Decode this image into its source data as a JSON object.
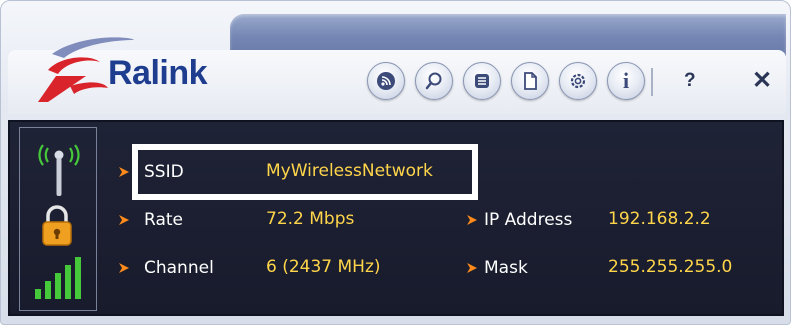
{
  "app": {
    "logo_text": "Ralink"
  },
  "toolbar": {
    "buttons": [
      {
        "icon": "rss-icon"
      },
      {
        "icon": "search-icon"
      },
      {
        "icon": "list-icon"
      },
      {
        "icon": "document-icon"
      },
      {
        "icon": "gear-icon"
      },
      {
        "icon": "info-icon",
        "glyph": "i"
      }
    ],
    "help": "?",
    "close": "✕"
  },
  "status": {
    "icons": [
      "antenna-icon",
      "lock-icon",
      "signal-bars-icon"
    ],
    "colors": {
      "signal": "#45c93a",
      "lock": "#f0a020",
      "value": "#ffd54a",
      "bullet": "#ff8a1a"
    }
  },
  "info": {
    "ssid": {
      "label": "SSID",
      "value": "MyWirelessNetwork"
    },
    "rate": {
      "label": "Rate",
      "value": "72.2 Mbps"
    },
    "channel": {
      "label": "Channel",
      "value": "6 (2437 MHz)"
    },
    "ip": {
      "label": "IP Address",
      "value": "192.168.2.2"
    },
    "mask": {
      "label": "Mask",
      "value": "255.255.255.0"
    }
  }
}
